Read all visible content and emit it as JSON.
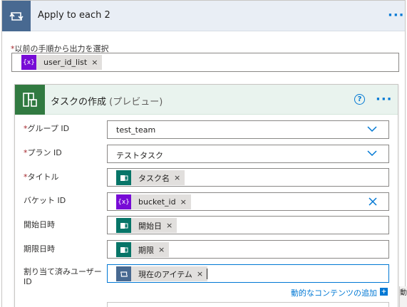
{
  "outer": {
    "title": "Apply to each 2",
    "icon": "loop-icon",
    "more": "···",
    "select_label": "以前の手順から出力を選択",
    "required_mark": "*",
    "token": {
      "icon": "variable-icon",
      "icon_text": "{x}",
      "label": "user_id_list",
      "remove": "×"
    }
  },
  "inner": {
    "title": "タスクの作成",
    "title_suffix": "(プレビュー)",
    "icon": "planner-icon",
    "help": "?",
    "more": "···",
    "fields": {
      "group_id": {
        "label": "グループ ID",
        "required": "*",
        "value": "test_team"
      },
      "plan_id": {
        "label": "プラン ID",
        "required": "*",
        "value": "テストタスク"
      },
      "title": {
        "label": "タイトル",
        "required": "*",
        "token_label": "タスク名",
        "remove": "×"
      },
      "bucket_id": {
        "label": "バケット ID",
        "token_icon_text": "{x}",
        "token_label": "bucket_id",
        "remove": "×"
      },
      "start_date": {
        "label": "開始日時",
        "token_label": "開始日",
        "remove": "×"
      },
      "due_date": {
        "label": "期限日時",
        "token_label": "期限",
        "remove": "×"
      },
      "assignees": {
        "label": "割り当て済みユーザー ID",
        "token_label": "現在のアイテム",
        "remove": "×"
      }
    },
    "dynamic_content_link": "動的なコンテンツの追加",
    "dynamic_plus": "+"
  },
  "side_flyout": {
    "text": "動"
  },
  "colors": {
    "loop_accent": "#486991",
    "planner_accent": "#317a41",
    "variable_token": "#770bd6",
    "planner_token": "#077568",
    "link": "#0078d4",
    "required": "#a4262c"
  }
}
